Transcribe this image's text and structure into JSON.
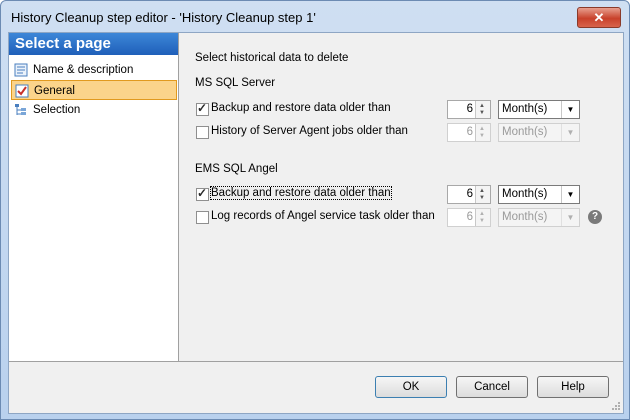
{
  "window": {
    "title": "History Cleanup step editor - 'History Cleanup step 1'",
    "close_glyph": "✕"
  },
  "left_pane": {
    "header": "Select a page",
    "items": [
      {
        "label": "Name & description",
        "icon": "page-icon",
        "selected": false
      },
      {
        "label": "General",
        "icon": "checklist-icon",
        "selected": true
      },
      {
        "label": "Selection",
        "icon": "tree-icon",
        "selected": false
      }
    ]
  },
  "main": {
    "heading": "Select historical data to delete",
    "groups": [
      {
        "title": "MS SQL Server",
        "rows": [
          {
            "label": "Backup and restore data older than",
            "checked": true,
            "value": "6",
            "unit": "Month(s)",
            "enabled": true
          },
          {
            "label": "History of Server Agent jobs older than",
            "checked": false,
            "value": "6",
            "unit": "Month(s)",
            "enabled": false
          }
        ]
      },
      {
        "title": "EMS SQL Angel",
        "rows": [
          {
            "label": "Backup and restore data older than",
            "checked": true,
            "value": "6",
            "unit": "Month(s)",
            "enabled": true
          },
          {
            "label": "Log records of Angel service task older than",
            "checked": false,
            "value": "6",
            "unit": "Month(s)",
            "enabled": false
          }
        ]
      }
    ],
    "help_glyph": "?"
  },
  "buttons": {
    "ok": "OK",
    "cancel": "Cancel",
    "help": "Help"
  },
  "colors": {
    "header_blue": "#2a6fc9",
    "selection_bg": "#fbd48b",
    "close_red": "#c8412b"
  }
}
